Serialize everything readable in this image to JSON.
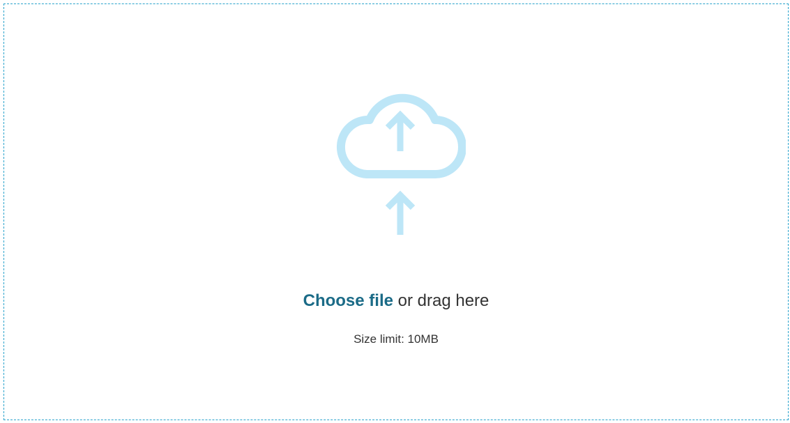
{
  "colors": {
    "border": "#2aa3cc",
    "icon": "#bde6f7",
    "link": "#1b6b87",
    "text": "#333333"
  },
  "dropzone": {
    "icons": {
      "cloud": "cloud-upload-icon",
      "arrow": "arrow-up-icon"
    },
    "choose_file_label": "Choose file",
    "drag_text": "or drag here",
    "size_limit": "Size limit: 10MB"
  }
}
